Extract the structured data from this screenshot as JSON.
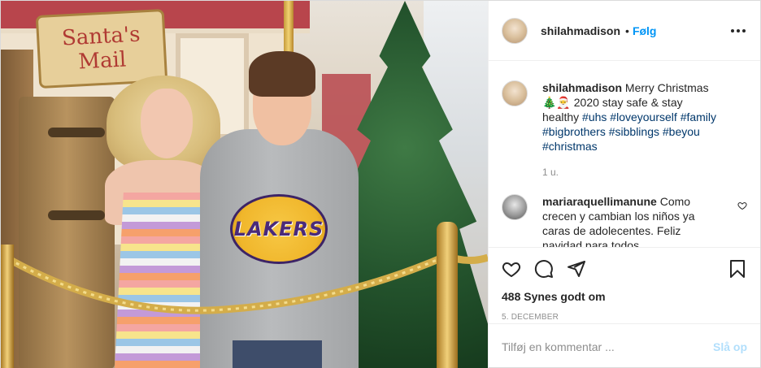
{
  "header": {
    "username": "shilahmadison",
    "separator": "•",
    "follow_label": "Følg",
    "more_icon": "more-horizontal-icon"
  },
  "photo": {
    "sign_line1": "Santa's",
    "sign_line2": "Mail",
    "shirt_text": "LAKERS"
  },
  "caption": {
    "username": "shilahmadison",
    "text_before": "Merry Christmas 🎄🎅 2020 stay safe & stay healthy ",
    "tags": [
      "#uhs",
      "#loveyourself",
      "#family",
      "#bigbrothers",
      "#sibblings",
      "#beyou",
      "#christmas"
    ],
    "time": "1 u."
  },
  "comments": [
    {
      "username": "mariaraquellimanune",
      "text": "Como crecen y cambian los niños ya caras de adolecentes. Feliz navidad para todos"
    }
  ],
  "actions": {
    "icons": [
      "heart-icon",
      "comment-icon",
      "share-icon",
      "bookmark-icon"
    ],
    "likes": "488 Synes godt om",
    "date": "5. DECEMBER"
  },
  "comment_box": {
    "placeholder": "Tilføj en kommentar ...",
    "post_label": "Slå op"
  },
  "colors": {
    "link": "#0095f6",
    "hashtag": "#00376b",
    "muted": "#8e8e8e",
    "post_disabled": "#b2dffc"
  }
}
